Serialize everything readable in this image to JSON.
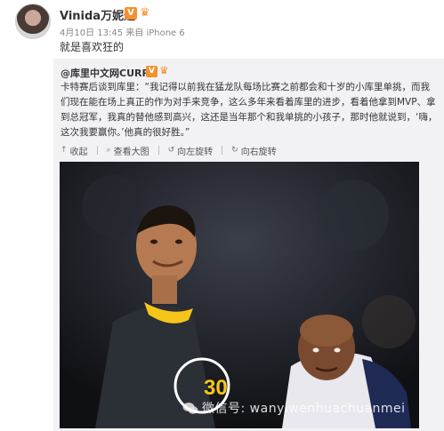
{
  "post": {
    "username": "Vinida万妮达",
    "vip_badge": "V",
    "meta": "4月10日 13:45 来自 iPhone 6",
    "text": "就是喜欢狂的"
  },
  "repost": {
    "author": "@库里中文网CURRY",
    "vip_badge": "V",
    "text": "卡特赛后谈到库里：“我记得以前我在猛龙队每场比赛之前都会和十岁的小库里单挑，而我们现在能在场上真正的作为对手来竞争，这么多年来看着库里的进步，看着他拿到MVP、拿到总冠军，我真的替他感到高兴，这还是当年那个和我单挑的小孩子，那时他就说到，‘嗨，这次我要赢你。’他真的很好胜。”",
    "actions": [
      "收起",
      "查看大图",
      "向左旋转",
      "向右旋转"
    ]
  },
  "photo": {
    "jersey_number": "30",
    "alt": "photo"
  },
  "watermark": {
    "text": "微信号: wanyiwenhuachuanmei"
  },
  "colors": {
    "accent_orange": "#f29130",
    "repost_bg": "#f2f2f5",
    "jersey_dark": "#2b2f36",
    "jersey_trim": "#f5c518"
  }
}
